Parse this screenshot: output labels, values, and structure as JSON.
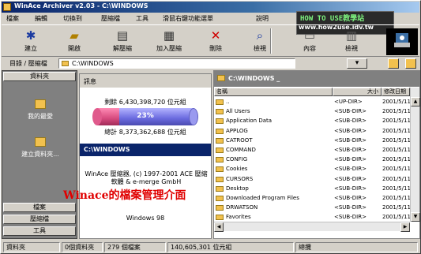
{
  "window": {
    "title": "WinAce Archiver v2.03 - C:\\WINDOWS"
  },
  "watermark": {
    "line1": "HOW TO USE教學站",
    "line2": "www.how2use.idv.tw"
  },
  "menu": [
    "檔案",
    "編輯",
    "切換到",
    "壓縮檔",
    "工具",
    "滑鼠右鍵功能選單",
    "說明"
  ],
  "toolbar": [
    {
      "label": "建立",
      "icon": "create-archive-icon"
    },
    {
      "label": "開啟",
      "icon": "open-folder-icon"
    },
    {
      "label": "解壓縮",
      "icon": "extract-icon"
    },
    {
      "label": "加入壓縮",
      "icon": "add-archive-icon"
    },
    {
      "label": "刪除",
      "icon": "delete-icon"
    },
    {
      "label": "檢視",
      "icon": "view-icon"
    },
    {
      "label": "內容",
      "icon": "properties-icon"
    },
    {
      "label": "檢視",
      "icon": "view-mode-icon"
    }
  ],
  "address": {
    "label": "目錄 / 壓縮檔",
    "value": "C:\\WINDOWS"
  },
  "sidebar": {
    "title": "資料夾",
    "items": [
      {
        "label": "我的最愛"
      },
      {
        "label": "建立資料夾..."
      }
    ],
    "bottom_tabs": [
      "檔案",
      "壓縮檔",
      "工具"
    ]
  },
  "info": {
    "heading": "訊息",
    "deleted": "剩餘 6,430,398,720 位元組",
    "percent_label": "23%",
    "percent": 0.23,
    "total": "總計 8,373,362,688 位元組",
    "path": "C:\\WINDOWS",
    "copyright": "WinAce 壓縮器, (c) 1997-2001 ACE 壓縮軟體 & e-merge GmbH",
    "os": "Windows 98"
  },
  "caption": "Winace的檔案管理介面",
  "filelist": {
    "path": "C:\\WINDOWS _",
    "columns": [
      "名稱",
      "大小",
      "修改日期"
    ],
    "rows": [
      {
        "name": "..",
        "size": "<UP-DIR>",
        "date": "2001/5/11 下"
      },
      {
        "name": "All Users",
        "size": "<SUB-DIR>",
        "date": "2001/5/11 下"
      },
      {
        "name": "Application Data",
        "size": "<SUB-DIR>",
        "date": "2001/5/11 下"
      },
      {
        "name": "APPLOG",
        "size": "<SUB-DIR>",
        "date": "2001/5/11 下"
      },
      {
        "name": "CATROOT",
        "size": "<SUB-DIR>",
        "date": "2001/5/11 下"
      },
      {
        "name": "COMMAND",
        "size": "<SUB-DIR>",
        "date": "2001/5/11 下"
      },
      {
        "name": "CONFIG",
        "size": "<SUB-DIR>",
        "date": "2001/5/11 下"
      },
      {
        "name": "Cookies",
        "size": "<SUB-DIR>",
        "date": "2001/5/11 下"
      },
      {
        "name": "CURSORS",
        "size": "<SUB-DIR>",
        "date": "2001/5/11 下"
      },
      {
        "name": "Desktop",
        "size": "<SUB-DIR>",
        "date": "2001/5/11 下"
      },
      {
        "name": "Downloaded Program Files",
        "size": "<SUB-DIR>",
        "date": "2001/5/11 下"
      },
      {
        "name": "DRWATSON",
        "size": "<SUB-DIR>",
        "date": "2001/5/11 下"
      },
      {
        "name": "Favorites",
        "size": "<SUB-DIR>",
        "date": "2001/5/11 下"
      },
      {
        "name": "FONTS",
        "size": "<SUB-DIR>",
        "date": "2001/5/11 下"
      }
    ]
  },
  "status": {
    "left": "資料夾",
    "folders": "0個資料夾",
    "files": "279 個檔案",
    "bytes": "140,605,301 位元組",
    "right": "總攬"
  }
}
